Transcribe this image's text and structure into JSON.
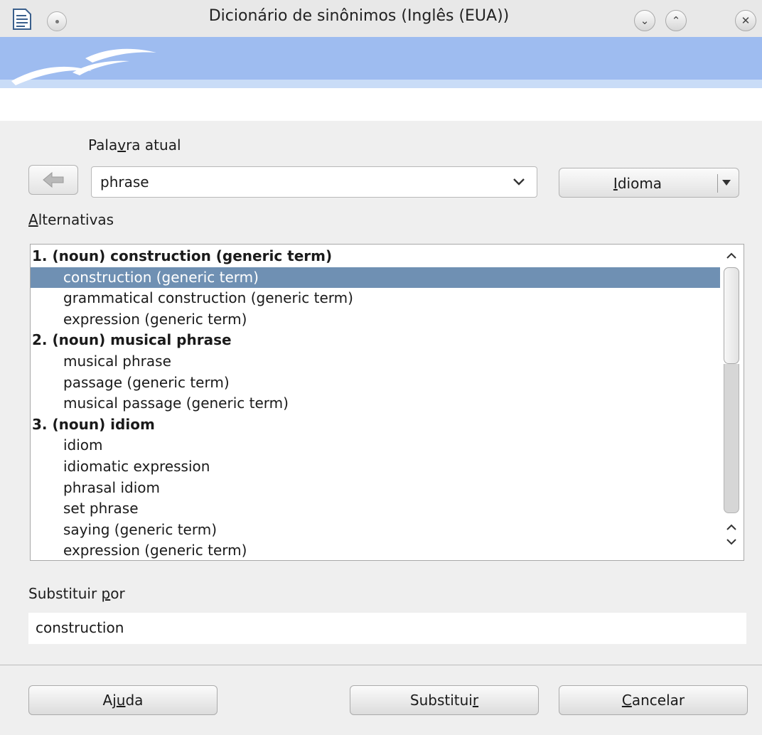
{
  "window": {
    "title": "Dicionário de sinônimos (Inglês (EUA))",
    "buttons": [
      "minimize",
      "maximize",
      "close"
    ]
  },
  "current_word": {
    "label_prefix": "Pala",
    "label_mnemonic": "v",
    "label_suffix": "ra atual",
    "value": "phrase"
  },
  "language_button": {
    "label_mnemonic": "I",
    "label_suffix": "dioma"
  },
  "alternatives": {
    "label_mnemonic": "A",
    "label_suffix": "lternativas",
    "rows": [
      {
        "text": "1. (noun) construction (generic term)",
        "kind": "header"
      },
      {
        "text": "construction (generic term)",
        "kind": "item",
        "selected": true
      },
      {
        "text": "grammatical construction (generic term)",
        "kind": "item"
      },
      {
        "text": "expression (generic term)",
        "kind": "item"
      },
      {
        "text": "2. (noun) musical phrase",
        "kind": "header"
      },
      {
        "text": "musical phrase",
        "kind": "item"
      },
      {
        "text": "passage (generic term)",
        "kind": "item"
      },
      {
        "text": "musical passage (generic term)",
        "kind": "item"
      },
      {
        "text": "3. (noun) idiom",
        "kind": "header"
      },
      {
        "text": "idiom",
        "kind": "item"
      },
      {
        "text": "idiomatic expression",
        "kind": "item"
      },
      {
        "text": "phrasal idiom",
        "kind": "item"
      },
      {
        "text": "set phrase",
        "kind": "item"
      },
      {
        "text": "saying (generic term)",
        "kind": "item"
      },
      {
        "text": "expression (generic term)",
        "kind": "item"
      }
    ]
  },
  "replace": {
    "label_prefix": "Substituir ",
    "label_mnemonic": "p",
    "label_suffix": "or",
    "value": "construction"
  },
  "buttons": {
    "help": {
      "prefix": "Aj",
      "mnemonic": "u",
      "suffix": "da"
    },
    "replace": {
      "prefix": "Substitui",
      "mnemonic": "r",
      "suffix": ""
    },
    "cancel": {
      "prefix": "",
      "mnemonic": "C",
      "suffix": "ancelar"
    }
  },
  "colors": {
    "banner": "#9ebcf0",
    "selection": "#6f90b3"
  }
}
